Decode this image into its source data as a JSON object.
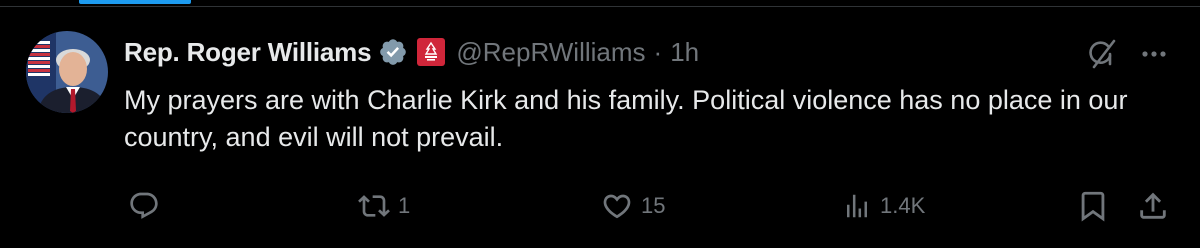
{
  "tweet": {
    "author": {
      "display_name": "Rep. Roger Williams",
      "handle": "@RepRWilliams",
      "verified": true,
      "verified_color": "#829aab",
      "affiliation_badge_color": "#d0263a",
      "avatar_icon": "avatar"
    },
    "separator": "·",
    "timestamp": "1h",
    "text": "My prayers are with Charlie Kirk and his family. Political violence has no place in our country, and evil will not prevail.",
    "header_icons": [
      "grok-icon",
      "more-icon"
    ],
    "actions": {
      "reply": {
        "icon": "reply-icon",
        "count": ""
      },
      "repost": {
        "icon": "repost-icon",
        "count": "1"
      },
      "like": {
        "icon": "like-icon",
        "count": "15"
      },
      "views": {
        "icon": "views-icon",
        "count": "1.4K"
      },
      "bookmark": {
        "icon": "bookmark-icon"
      },
      "share": {
        "icon": "share-icon"
      }
    }
  },
  "colors": {
    "background": "#000000",
    "text_primary": "#e7e9ea",
    "text_secondary": "#71767b",
    "accent": "#1d9bf0",
    "divider": "#2f3336"
  }
}
